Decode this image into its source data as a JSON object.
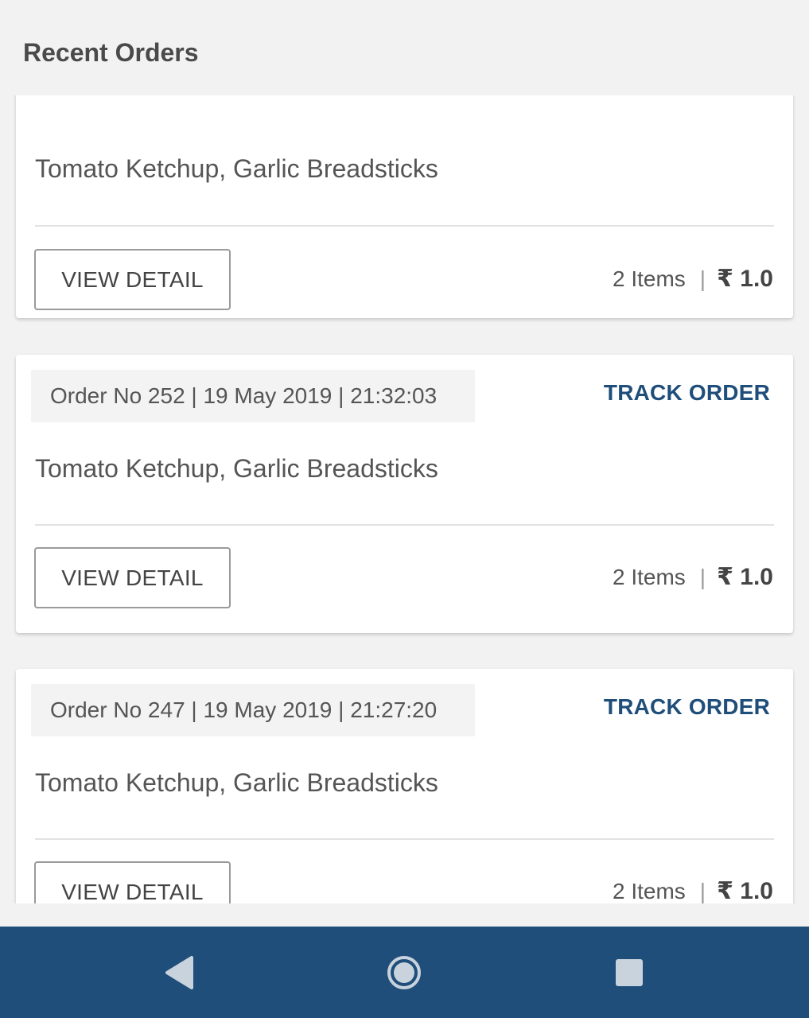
{
  "header": {
    "title": "Recent Orders"
  },
  "orders": [
    {
      "meta": "",
      "track_label": "",
      "items": "Tomato Ketchup, Garlic Breadsticks",
      "view_label": "VIEW DETAIL",
      "count": "2 Items",
      "separator": "|",
      "price": "₹ 1.0"
    },
    {
      "meta": "Order No 252 | 19 May 2019 | 21:32:03",
      "track_label": "TRACK ORDER",
      "items": "Tomato Ketchup, Garlic Breadsticks",
      "view_label": "VIEW DETAIL",
      "count": "2 Items",
      "separator": "|",
      "price": "₹ 1.0"
    },
    {
      "meta": "Order No 247 | 19 May 2019 | 21:27:20",
      "track_label": "TRACK ORDER",
      "items": "Tomato Ketchup, Garlic Breadsticks",
      "view_label": "VIEW DETAIL",
      "count": "2 Items",
      "separator": "|",
      "price": "₹ 1.0"
    }
  ],
  "navbar": {
    "back_icon": "back-triangle-icon",
    "home_icon": "home-circle-icon",
    "recent_icon": "recent-square-icon"
  },
  "colors": {
    "accent": "#1f4e7a",
    "background": "#f2f2f2",
    "card": "#ffffff"
  }
}
